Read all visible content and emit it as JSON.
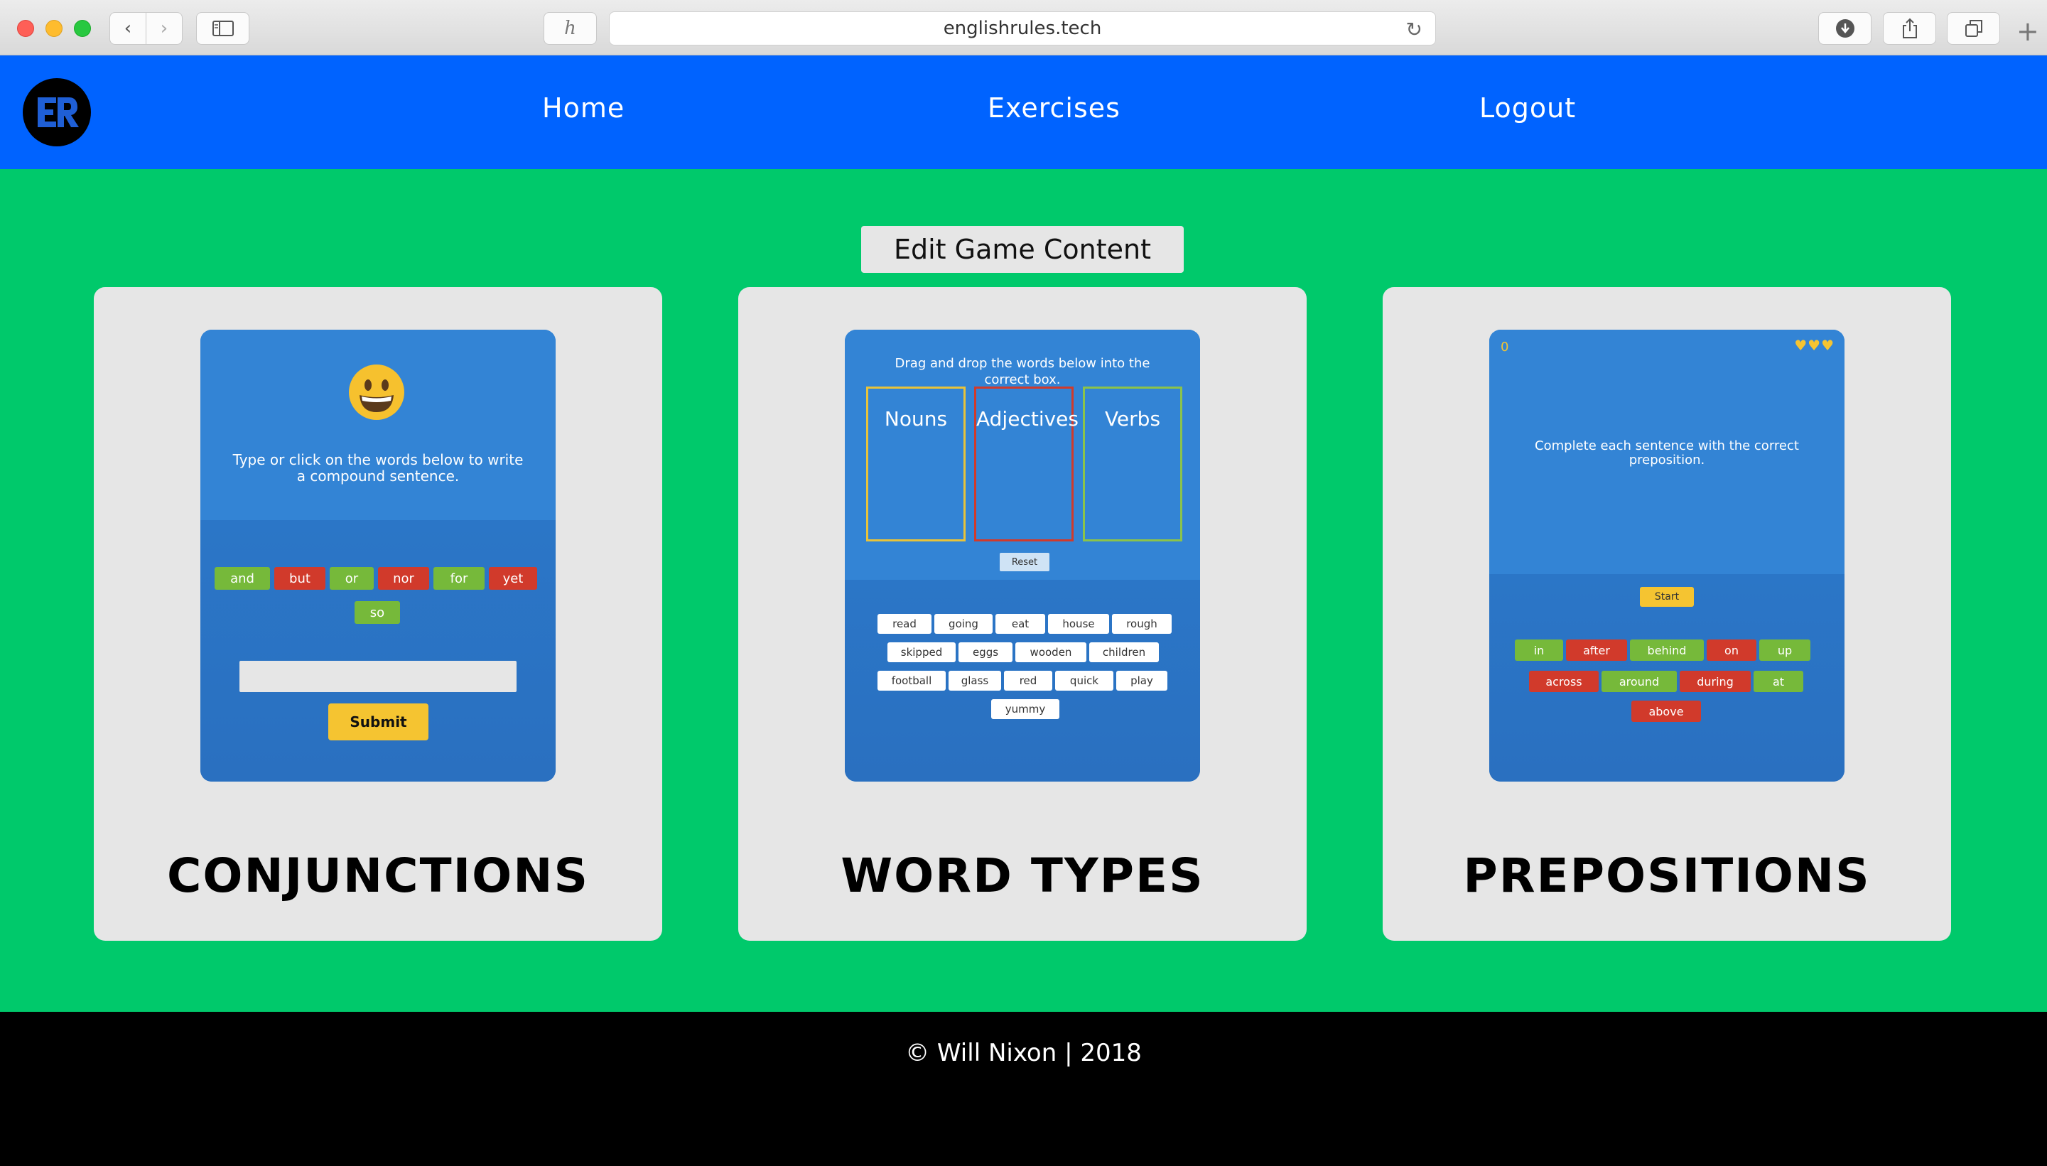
{
  "browser": {
    "url": "englishrules.tech",
    "honey_glyph": "h",
    "back_glyph": "‹",
    "forward_glyph": "›",
    "reload_glyph": "↻",
    "newtab_glyph": "+"
  },
  "nav": {
    "logo_icon": "er-logo-icon",
    "items": [
      {
        "label": "Home"
      },
      {
        "label": "Exercises"
      },
      {
        "label": "Logout"
      }
    ]
  },
  "main": {
    "edit_button": "Edit Game Content",
    "cards": [
      {
        "title": "CONJUNCTIONS",
        "game": {
          "emoji": "smiley-icon",
          "instruction": "Type or click on the words below to write a compound sentence.",
          "words": [
            "and",
            "but",
            "or",
            "nor",
            "for",
            "yet",
            "so"
          ],
          "submit": "Submit"
        }
      },
      {
        "title": "WORD TYPES",
        "game": {
          "instruction": "Drag and drop the words below into the correct box.",
          "boxes": [
            "Nouns",
            "Adjectives",
            "Verbs"
          ],
          "box_colors": [
            "#e8c33a",
            "#d13a2b",
            "#8bc34a"
          ],
          "reset": "Reset",
          "words": [
            "read",
            "going",
            "eat",
            "house",
            "rough",
            "skipped",
            "eggs",
            "wooden",
            "children",
            "football",
            "glass",
            "red",
            "quick",
            "play",
            "yummy"
          ]
        }
      },
      {
        "title": "PREPOSITIONS",
        "game": {
          "score": "0",
          "hearts": "♥♥♥",
          "instruction": "Complete each sentence with the correct preposition.",
          "start": "Start",
          "words": [
            "in",
            "after",
            "behind",
            "on",
            "up",
            "across",
            "around",
            "during",
            "at",
            "above"
          ]
        }
      }
    ]
  },
  "footer": {
    "text": "© Will Nixon | 2018"
  },
  "colors": {
    "nav_bg": "#0063ff",
    "main_bg": "#00c96b",
    "card_bg": "#e6e6e6",
    "chip_green": "#76b93a",
    "chip_red": "#d13a2b",
    "button_yellow": "#f5c431"
  }
}
